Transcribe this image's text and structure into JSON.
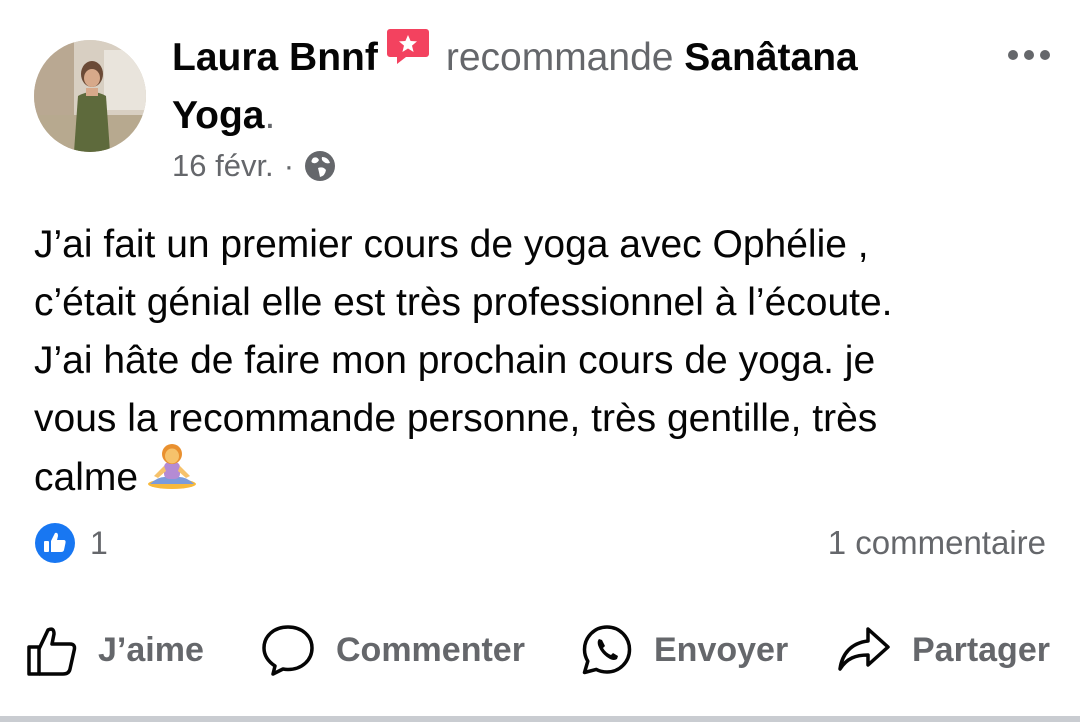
{
  "post": {
    "author": "Laura Bnnf",
    "verb": "recommande",
    "page_name": "Sanâtana Yoga",
    "trailing_dot": ".",
    "date": "16 févr.",
    "separator": "·",
    "body": "J’ai fait un premier cours de yoga avec Ophélie ,\nc’était génial elle est très professionnel à l’écoute.\nJ’ai hâte de faire mon prochain cours de yoga. je\nvous la recommande personne, très gentille, très\ncalme"
  },
  "icons": {
    "recommend": "recommend-badge-icon",
    "privacy": "globe-icon",
    "emoji": "woman-in-lotus-position-emoji",
    "reaction": "like-reaction-icon",
    "more": "more-options-icon"
  },
  "stats": {
    "reactions_count": "1",
    "comments": "1 commentaire"
  },
  "actions": {
    "like": "J’aime",
    "comment": "Commenter",
    "send": "Envoyer",
    "share": "Partager"
  },
  "colors": {
    "primary_text": "#050505",
    "secondary_text": "#65676b",
    "like_blue": "#1877f2",
    "recommend_pink": "#f3425f"
  }
}
